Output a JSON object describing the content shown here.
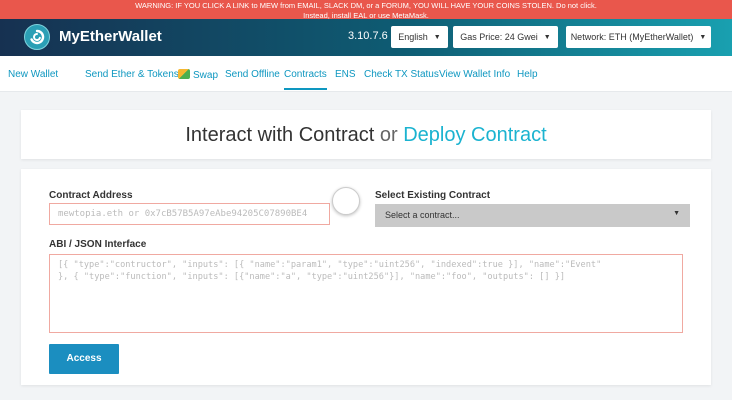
{
  "warning": {
    "line1": "WARNING: IF YOU CLICK A LINK to MEW from EMAIL, SLACK DM, or a FORUM, YOU WILL HAVE YOUR COINS STOLEN. Do not click.",
    "line2_prefix": "Instead, install",
    "link1": "EAL",
    "middle": "or use",
    "link2": "MetaMask",
    "suffix": "."
  },
  "header": {
    "brand": "MyEtherWallet",
    "version": "3.10.7.6",
    "language": "English",
    "gas_price": "Gas Price: 24 Gwei",
    "network": "Network: ETH (MyEtherWallet)"
  },
  "nav": {
    "new_wallet": "New Wallet",
    "send": "Send Ether & Tokens",
    "swap": "Swap",
    "send_offline": "Send Offline",
    "contracts": "Contracts",
    "ens": "ENS",
    "check_tx": "Check TX Status",
    "view_wallet": "View Wallet Info",
    "help": "Help"
  },
  "main": {
    "title_part1": "Interact with Contract",
    "title_or": "or",
    "title_part2": "Deploy Contract",
    "contract_address_label": "Contract Address",
    "contract_address_placeholder": "mewtopia.eth or 0x7cB57B5A97eAbe94205C07890BE4",
    "select_existing_label": "Select Existing Contract",
    "select_placeholder": "Select a contract...",
    "abi_label": "ABI / JSON Interface",
    "abi_placeholder": "[{ \"type\":\"contructor\", \"inputs\": [{ \"name\":\"param1\", \"type\":\"uint256\", \"indexed\":true }], \"name\":\"Event\"\n}, { \"type\":\"function\", \"inputs\": [{\"name\":\"a\", \"type\":\"uint256\"}], \"name\":\"foo\", \"outputs\": [] }]",
    "access_button": "Access"
  }
}
